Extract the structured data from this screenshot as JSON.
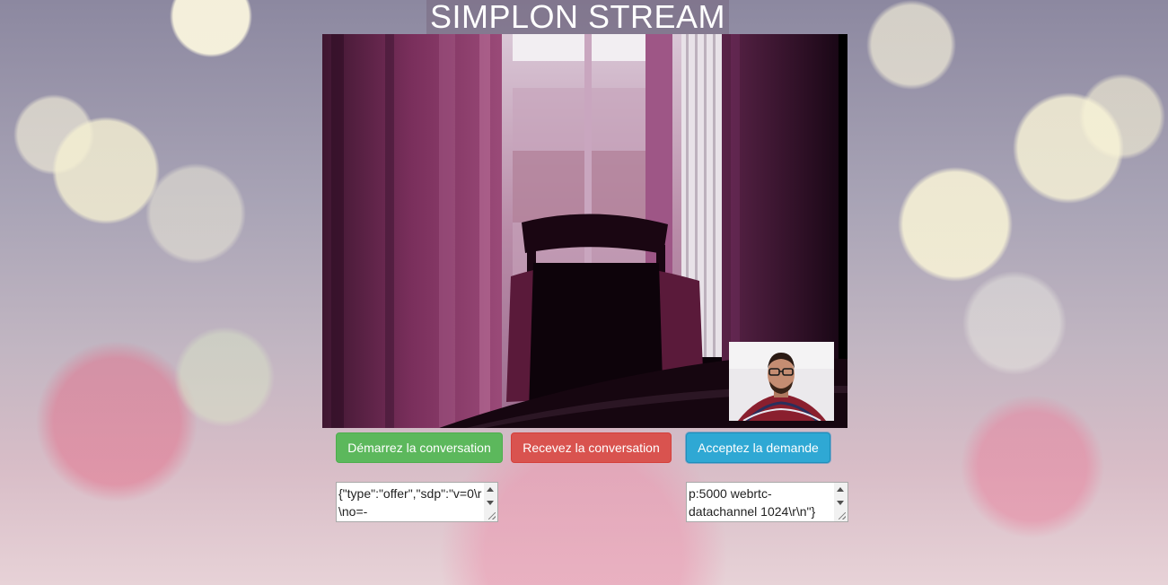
{
  "app": {
    "title": "SIMPLON STREAM"
  },
  "videos": {
    "remote_label": "remote-video-feed",
    "local_label": "local-video-feed"
  },
  "buttons": {
    "start_label": "Démarrez la conversation",
    "receive_label": "Recevez la conversation",
    "accept_label": "Acceptez la demande"
  },
  "textareas": {
    "offer_text": "{\"type\":\"offer\",\"sdp\":\"v=0\\r\\no=-",
    "answer_line1": "p:5000 webrtc-",
    "answer_line2": "datachannel 1024\\r\\n\"}"
  },
  "colors": {
    "start": "#5cb85c",
    "receive": "#d9534f",
    "accept": "#2fa8d4"
  }
}
